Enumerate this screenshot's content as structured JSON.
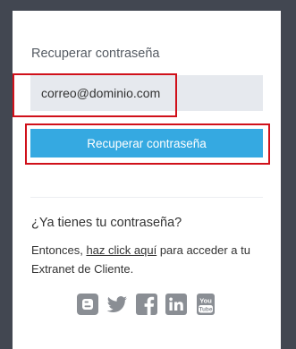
{
  "form": {
    "title": "Recuperar contraseña",
    "email_value": "correo@dominio.com",
    "submit_label": "Recuperar contraseña"
  },
  "login_prompt": {
    "question": "¿Ya tienes tu contraseña?",
    "text_before": "Entonces, ",
    "link_text": "haz click aquí",
    "text_after": " para acceder a tu Extranet de Cliente."
  },
  "social": {
    "icons": [
      "blogger-icon",
      "twitter-icon",
      "facebook-icon",
      "linkedin-icon",
      "youtube-icon"
    ],
    "icon_color": "#8a8e94"
  },
  "colors": {
    "background": "#424751",
    "card": "#ffffff",
    "accent": "#35a9e1",
    "highlight": "#d0101a",
    "input_bg": "#e6e9ee"
  }
}
